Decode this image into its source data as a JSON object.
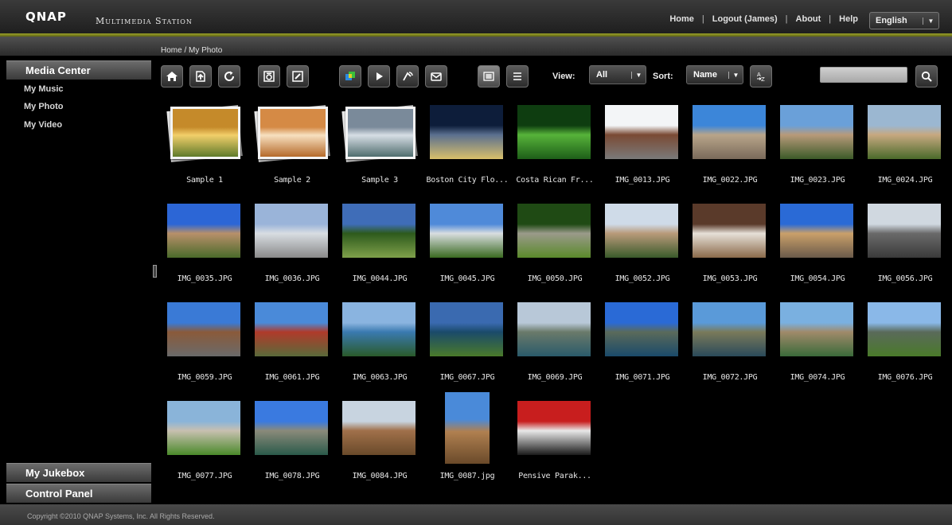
{
  "header": {
    "logo": "QNAP",
    "app_title": "Multimedia Station",
    "nav": [
      "Home",
      "Logout (James)",
      "About",
      "Help"
    ],
    "language": "English"
  },
  "breadcrumb": "Home / My Photo",
  "sidebar": {
    "media_center": "Media Center",
    "items": [
      "My Music",
      "My Photo",
      "My Video"
    ],
    "jukebox": "My Jukebox",
    "control_panel": "Control Panel"
  },
  "toolbar": {
    "view_label": "View:",
    "view_value": "All",
    "sort_label": "Sort:",
    "sort_value": "Name",
    "search_placeholder": ""
  },
  "items": [
    {
      "name": "Sample 1",
      "kind": "album",
      "colors": [
        "#c58a2a",
        "#f2cf6a",
        "#5f7a2a"
      ]
    },
    {
      "name": "Sample 2",
      "kind": "album",
      "colors": [
        "#d58a45",
        "#f7e0c0",
        "#b56a2a"
      ]
    },
    {
      "name": "Sample 3",
      "kind": "album",
      "colors": [
        "#7a8a9a",
        "#d7dee5",
        "#4f6d6e"
      ]
    },
    {
      "name": "Boston City Flo...",
      "kind": "photo",
      "colors": [
        "#0d1d3a",
        "#5a6f8f",
        "#d9c06a"
      ]
    },
    {
      "name": "Costa Rican Fr...",
      "kind": "photo",
      "colors": [
        "#0e3d10",
        "#57b33a",
        "#1d5e18"
      ]
    },
    {
      "name": "IMG_0013.JPG",
      "kind": "photo",
      "colors": [
        "#f3f5f7",
        "#7a4a34",
        "#7a7a7a"
      ]
    },
    {
      "name": "IMG_0022.JPG",
      "kind": "photo",
      "colors": [
        "#3c86d9",
        "#b8a58a",
        "#7a6a5a"
      ]
    },
    {
      "name": "IMG_0023.JPG",
      "kind": "photo",
      "colors": [
        "#6aa0d9",
        "#b89a7a",
        "#3c5a28"
      ]
    },
    {
      "name": "IMG_0024.JPG",
      "kind": "photo",
      "colors": [
        "#9bb7d1",
        "#c7a880",
        "#4a6a2a"
      ]
    },
    {
      "name": "IMG_0035.JPG",
      "kind": "photo",
      "colors": [
        "#2c66d6",
        "#b8906a",
        "#4a6a2a"
      ]
    },
    {
      "name": "IMG_0036.JPG",
      "kind": "photo",
      "colors": [
        "#9ab4d9",
        "#d8dde2",
        "#8a8a8a"
      ]
    },
    {
      "name": "IMG_0044.JPG",
      "kind": "photo",
      "colors": [
        "#3f6db8",
        "#2d5a1c",
        "#7fa04a"
      ]
    },
    {
      "name": "IMG_0045.JPG",
      "kind": "photo",
      "colors": [
        "#4f8ad9",
        "#d9dde0",
        "#3a6a20"
      ]
    },
    {
      "name": "IMG_0050.JPG",
      "kind": "photo",
      "colors": [
        "#1f4a14",
        "#9a9a8a",
        "#5a8a2a"
      ]
    },
    {
      "name": "IMG_0052.JPG",
      "kind": "photo",
      "colors": [
        "#cfdbe8",
        "#b99a7a",
        "#3a5a2a"
      ]
    },
    {
      "name": "IMG_0053.JPG",
      "kind": "photo",
      "colors": [
        "#5a3a2a",
        "#e6e0d8",
        "#8a6a4a"
      ]
    },
    {
      "name": "IMG_0054.JPG",
      "kind": "photo",
      "colors": [
        "#2a6ad6",
        "#caa06a",
        "#6a5a4a"
      ]
    },
    {
      "name": "IMG_0056.JPG",
      "kind": "photo",
      "colors": [
        "#d0d8e0",
        "#6a6a6a",
        "#3a3a3a"
      ]
    },
    {
      "name": "IMG_0059.JPG",
      "kind": "photo",
      "colors": [
        "#3a7ad6",
        "#8a5a3a",
        "#6a6a6a"
      ]
    },
    {
      "name": "IMG_0061.JPG",
      "kind": "photo",
      "colors": [
        "#4a8ad9",
        "#b03a2a",
        "#5a6a3a"
      ]
    },
    {
      "name": "IMG_0063.JPG",
      "kind": "photo",
      "colors": [
        "#8ab4e0",
        "#3a7ab0",
        "#2a5a2a"
      ]
    },
    {
      "name": "IMG_0067.JPG",
      "kind": "photo",
      "colors": [
        "#3a6ab0",
        "#1a4a6a",
        "#4a7a2a"
      ]
    },
    {
      "name": "IMG_0069.JPG",
      "kind": "photo",
      "colors": [
        "#b8c8d8",
        "#6a7a6a",
        "#2a5a6a"
      ]
    },
    {
      "name": "IMG_0071.JPG",
      "kind": "photo",
      "colors": [
        "#2a6ad6",
        "#5a6a5a",
        "#1a4a6a"
      ]
    },
    {
      "name": "IMG_0072.JPG",
      "kind": "photo",
      "colors": [
        "#5a9ad9",
        "#7a7a5a",
        "#2a4a5a"
      ]
    },
    {
      "name": "IMG_0074.JPG",
      "kind": "photo",
      "colors": [
        "#7ab0e0",
        "#a08a6a",
        "#3a6a3a"
      ]
    },
    {
      "name": "IMG_0076.JPG",
      "kind": "photo",
      "colors": [
        "#8ab8e8",
        "#5a6a5a",
        "#4a7a2a"
      ]
    },
    {
      "name": "IMG_0077.JPG",
      "kind": "photo",
      "colors": [
        "#8ab4d9",
        "#c8c0b0",
        "#4a8a2a"
      ]
    },
    {
      "name": "IMG_0078.JPG",
      "kind": "photo",
      "colors": [
        "#3a7ae0",
        "#8a8a7a",
        "#2a5a4a"
      ]
    },
    {
      "name": "IMG_0084.JPG",
      "kind": "photo",
      "colors": [
        "#c8d4e0",
        "#a0704a",
        "#6a4a2a"
      ]
    },
    {
      "name": "IMG_0087.jpg",
      "kind": "photo-portrait",
      "colors": [
        "#4a8ad9",
        "#b08050",
        "#6a4a2a"
      ]
    },
    {
      "name": "Pensive Parak...",
      "kind": "photo",
      "colors": [
        "#c81e1e",
        "#e8e8e8",
        "#1a1a1a"
      ]
    }
  ],
  "footer": "Copyright ©2010 QNAP Systems, Inc. All Rights Reserved.",
  "icons": [
    "home-icon",
    "up-folder-icon",
    "refresh-icon",
    "camera-icon",
    "edit-icon",
    "colors-icon",
    "play-icon",
    "rotate-icon",
    "mail-icon",
    "grid-view-icon",
    "list-view-icon",
    "sort-az-icon",
    "search-icon"
  ]
}
